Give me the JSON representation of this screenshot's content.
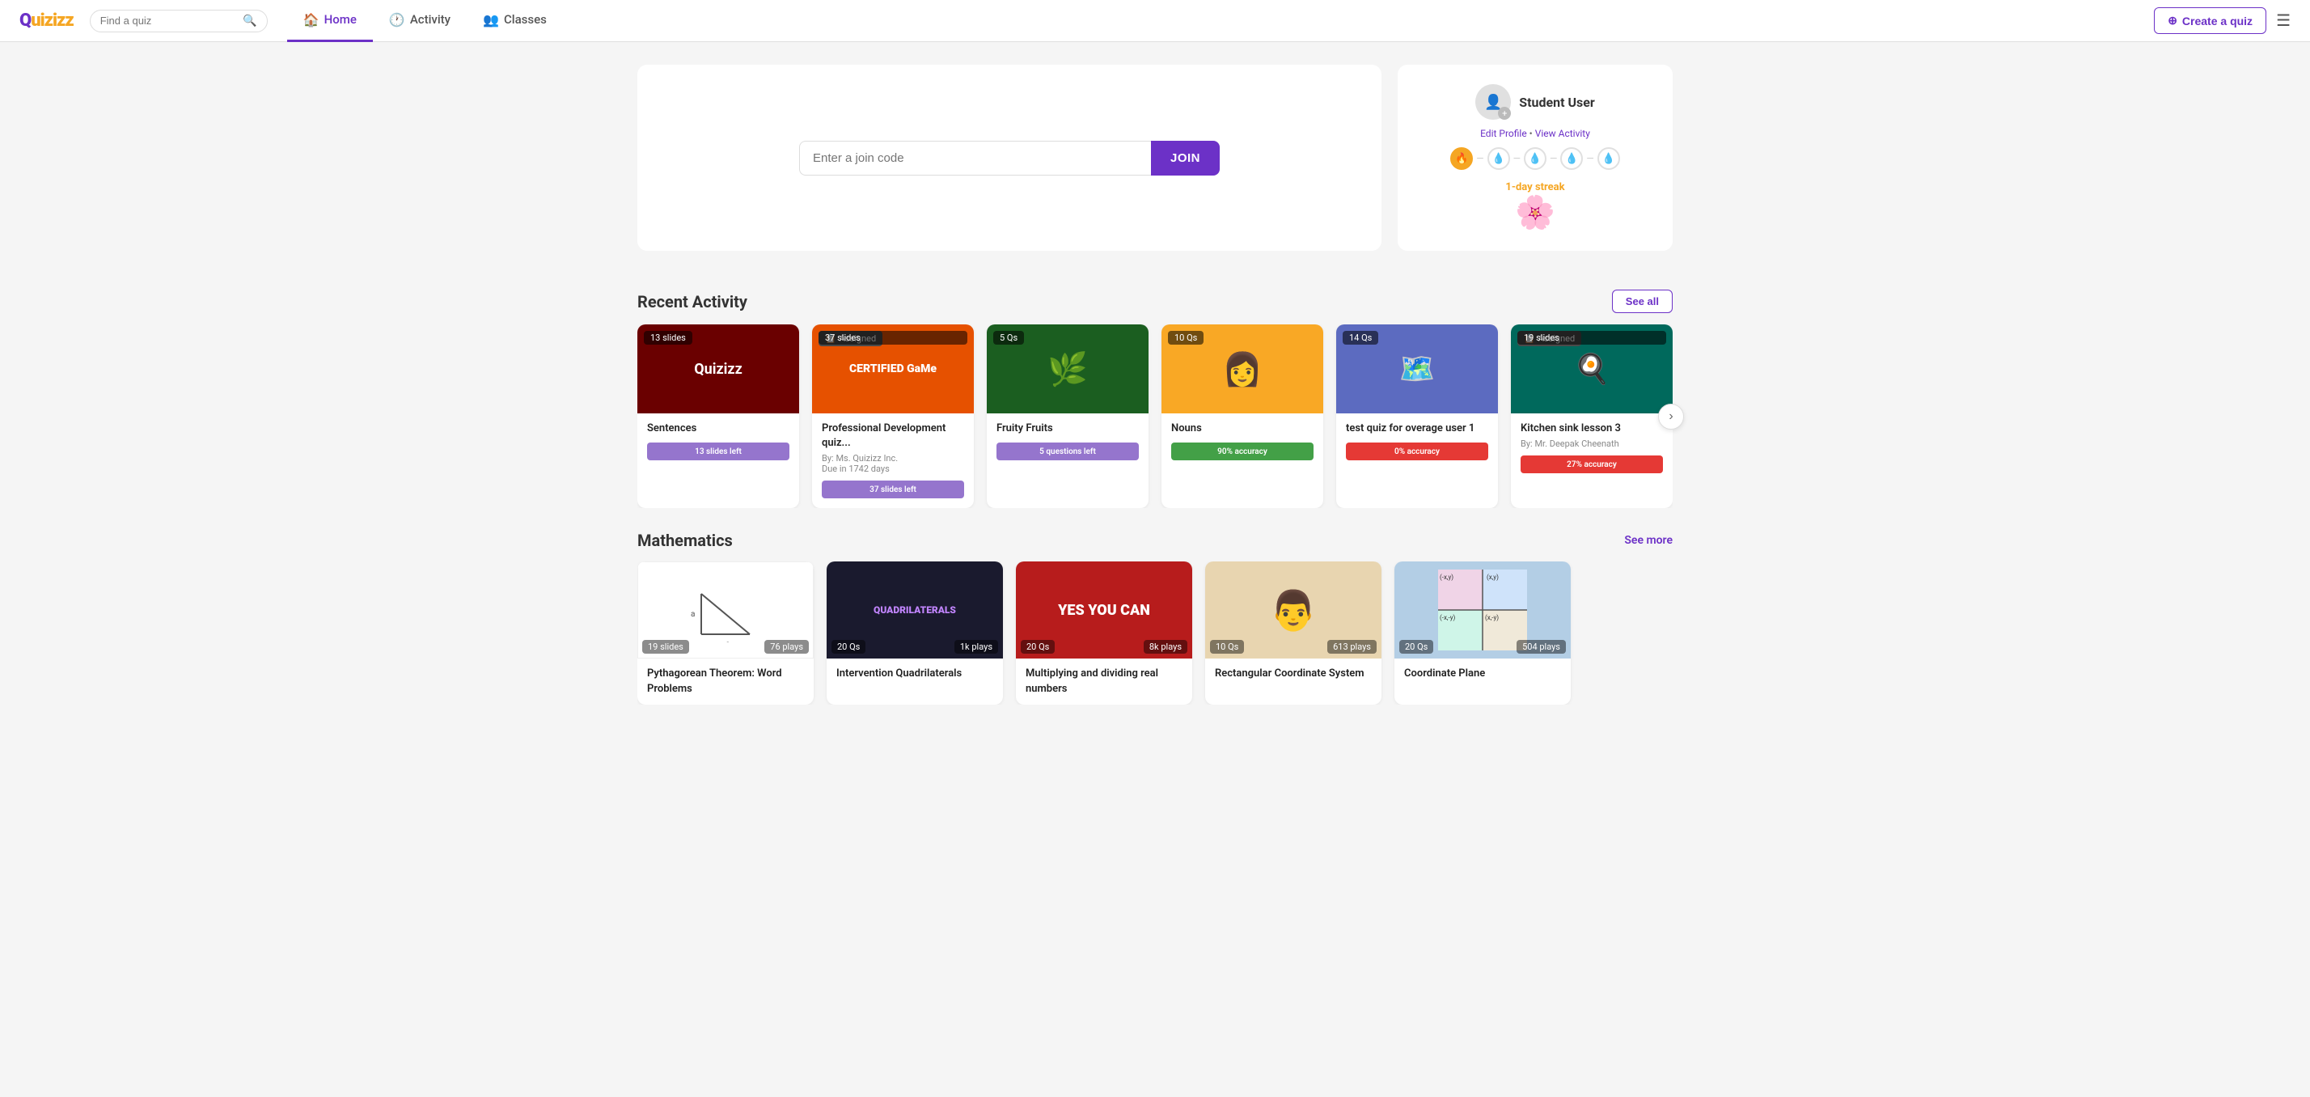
{
  "brand": {
    "logo_q": "Q",
    "logo_rest": "uizizz"
  },
  "navbar": {
    "search_placeholder": "Find a quiz",
    "home_label": "Home",
    "activity_label": "Activity",
    "classes_label": "Classes",
    "create_label": "Create a quiz"
  },
  "hero": {
    "join_placeholder": "Enter a join code",
    "join_btn": "JOIN",
    "profile_name": "Student User",
    "edit_profile": "Edit Profile",
    "view_activity": "View Activity",
    "streak_label": "1-day streak",
    "streak_dots": [
      true,
      false,
      false,
      false,
      false
    ]
  },
  "recent_activity": {
    "title": "Recent Activity",
    "see_all": "See all",
    "cards": [
      {
        "id": "sentences",
        "title": "Sentences",
        "badge_type": "count",
        "badge": "13 slides",
        "thumb_color": "thumb-dark-red",
        "thumb_text": "Quizizz",
        "progress_label": "13 slides left",
        "progress_type": "pb-purple",
        "by": "",
        "due": ""
      },
      {
        "id": "pro-dev",
        "title": "Professional Development quiz...",
        "badge_type": "assigned",
        "badge": "37 slides",
        "thumb_color": "thumb-orange",
        "thumb_text": "CERTIFIED GaMe",
        "progress_label": "37 slides left",
        "progress_type": "pb-purple",
        "by": "By: Ms. Quizizz Inc.",
        "due": "Due in 1742 days"
      },
      {
        "id": "fruity-fruits",
        "title": "Fruity Fruits",
        "badge_type": "count",
        "badge": "5 Qs",
        "thumb_color": "thumb-green",
        "thumb_text": "🌿",
        "progress_label": "5 questions left",
        "progress_type": "pb-purple",
        "by": "",
        "due": ""
      },
      {
        "id": "nouns",
        "title": "Nouns",
        "badge_type": "count",
        "badge": "10 Qs",
        "thumb_color": "thumb-yellow",
        "thumb_text": "👩",
        "progress_label": "90% accuracy",
        "progress_type": "pb-green",
        "by": "",
        "due": ""
      },
      {
        "id": "test-quiz",
        "title": "test quiz for overage user 1",
        "badge_type": "count",
        "badge": "14 Qs",
        "thumb_color": "thumb-map",
        "thumb_text": "🗺️",
        "progress_label": "0% accuracy",
        "progress_type": "pb-red",
        "by": "",
        "due": ""
      },
      {
        "id": "kitchen-sink",
        "title": "Kitchen sink lesson 3",
        "badge_type": "assigned",
        "badge": "19 slides",
        "thumb_color": "thumb-teal",
        "thumb_text": "🍳",
        "progress_label": "27% accuracy",
        "progress_type": "pb-red",
        "by": "By: Mr. Deepak Cheenath",
        "due": ""
      }
    ]
  },
  "mathematics": {
    "title": "Mathematics",
    "see_more": "See more",
    "cards": [
      {
        "id": "pythagorean",
        "title": "Pythagorean Theorem: Word Problems",
        "thumb_color": "thumb-white",
        "thumb_text": "📐",
        "slides_badge": "19 slides",
        "plays_badge": "76 plays"
      },
      {
        "id": "quadrilaterals",
        "title": "Intervention Quadrilaterals",
        "thumb_color": "thumb-dark",
        "thumb_text": "QUADRILATERALS",
        "slides_badge": "20 Qs",
        "plays_badge": "1k plays"
      },
      {
        "id": "multiplying",
        "title": "Multiplying and dividing real numbers",
        "thumb_color": "thumb-red",
        "thumb_text": "YES YOU CAN",
        "slides_badge": "20 Qs",
        "plays_badge": "8k plays"
      },
      {
        "id": "rectangular-coord",
        "title": "Rectangular Coordinate System",
        "thumb_color": "thumb-beige",
        "thumb_text": "👨",
        "slides_badge": "10 Qs",
        "plays_badge": "613 plays"
      },
      {
        "id": "coordinate-plane",
        "title": "Coordinate Plane",
        "thumb_color": "thumb-blue",
        "thumb_text": "📊",
        "slides_badge": "20 Qs",
        "plays_badge": "504 plays"
      }
    ]
  }
}
